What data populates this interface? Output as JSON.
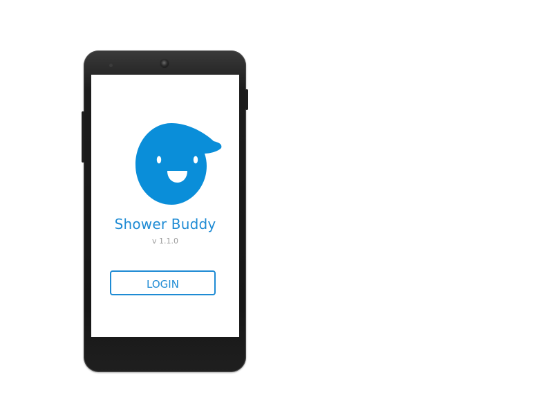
{
  "app": {
    "name": "Shower Buddy",
    "version": "v 1.1.0",
    "login_label": "LOGIN"
  },
  "logo": {
    "icon": "smiling-droplet-mascot",
    "color": "#0a8ed9"
  },
  "colors": {
    "accent": "#1e8bd4",
    "version_text": "#9a9a9a",
    "screen_background": "#ffffff",
    "device_body": "#1c1c1c"
  }
}
